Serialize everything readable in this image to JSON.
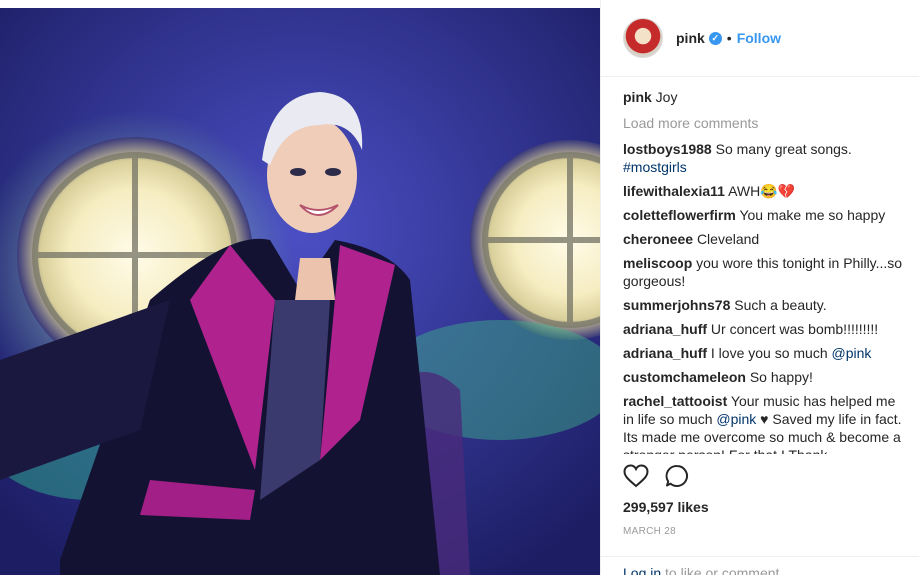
{
  "post": {
    "username": "pink",
    "separator": "•",
    "follow_label": "Follow",
    "caption_user": "pink",
    "caption_text": "Joy",
    "load_more_label": "Load more comments",
    "comments": [
      {
        "user": "lostboys1988",
        "text": "So many great songs.",
        "tag": "#mostgirls"
      },
      {
        "user": "lifewithalexia11",
        "text": "AWH😂💔"
      },
      {
        "user": "coletteflowerfirm",
        "text": "You make me so happy"
      },
      {
        "user": "cheroneee",
        "text": "Cleveland"
      },
      {
        "user": "meliscoop",
        "text": "you wore this tonight in Philly...so gorgeous!"
      },
      {
        "user": "summerjohns78",
        "text": "Such a beauty."
      },
      {
        "user": "adriana_huff",
        "text": "Ur concert was bomb!!!!!!!!!"
      },
      {
        "user": "adriana_huff",
        "text": "I love you so much",
        "tag": "@pink"
      },
      {
        "user": "customchameleon",
        "text": "So happy!"
      },
      {
        "user": "rachel_tattooist",
        "text_before": "Your music has helped me in life so much",
        "tag": "@pink",
        "text_after": "♥ Saved my life in fact. Its made me overcome so much & become a stronger person! For that I Thank"
      }
    ],
    "likes": "299,597 likes",
    "date": "MARCH 28",
    "login_link": "Log in",
    "login_text": "to like or comment."
  },
  "icons": {
    "heart": "heart-icon",
    "comment": "comment-icon",
    "verified": "verified-badge-icon"
  },
  "colors": {
    "link": "#3897f0",
    "tag": "#003569",
    "muted": "#999999",
    "text": "#262626",
    "jacket_accent": "#b0238f"
  }
}
